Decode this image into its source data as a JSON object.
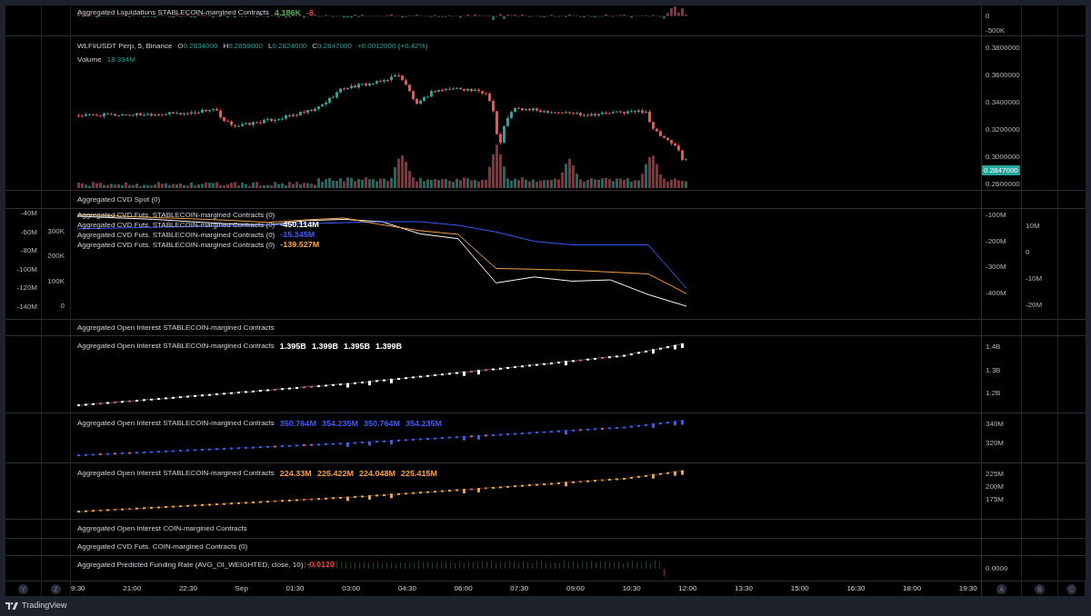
{
  "panes": [
    {
      "kind": "liquidations",
      "title": "Aggregated Liquidations STABLECOIN-margined Contracts",
      "values": [
        {
          "text": "4.186K",
          "color": "#4caf50"
        },
        {
          "text": "-8",
          "color": "#f23645"
        }
      ],
      "right_ticks": [
        "0",
        "-500K"
      ]
    },
    {
      "kind": "price",
      "title": "WLFI/USDT Perp, 5, Binance",
      "ohlc": [
        {
          "label": "O",
          "value": "0.2834000"
        },
        {
          "label": "H",
          "value": "0.2859000"
        },
        {
          "label": "L",
          "value": "0.2824000"
        },
        {
          "label": "C",
          "value": "0.2847000"
        }
      ],
      "change": "+0.0012000 (+0.42%)",
      "volume": {
        "label": "Volume",
        "value": "18.394M"
      },
      "right_ticks": [
        "0.3800000",
        "0.3600000",
        "0.3400000",
        "0.3200000",
        "0.3000000",
        "0.2600000"
      ],
      "last_price": "0.2847000"
    },
    {
      "kind": "header",
      "title": "Aggregated CVD Spot (0)"
    },
    {
      "kind": "cvd",
      "chart_data": {
        "type": "line",
        "ylim": [
          -501,
          -76
        ],
        "yticks": [
          {
            "value": -100,
            "label": "-100M"
          },
          {
            "value": -200,
            "label": "-200M"
          },
          {
            "value": -300,
            "label": "-300M"
          },
          {
            "value": -400,
            "label": "-400M"
          }
        ],
        "series": [
          {
            "color": "#ffffff",
            "values": [
              -104,
              -110,
              -116,
              -125,
              -134,
              -138,
              -121,
              -116,
              -125,
              -172,
              -191,
              -362,
              -339,
              -355,
              -350,
              -407,
              -452
            ]
          },
          {
            "color": "#3d5afe",
            "values": [
              -153,
              -150,
              -147,
              -144,
              -141,
              -138,
              -133,
              -129,
              -125,
              -125,
              -139,
              -165,
              -201,
              -215,
              -215,
              -215,
              -383
            ]
          },
          {
            "color": "#f5a142",
            "values": [
              -97,
              -103,
              -109,
              -114,
              -120,
              -128,
              -118,
              -111,
              -137,
              -160,
              -174,
              -306,
              -309,
              -313,
              -320,
              -327,
              -403
            ]
          }
        ]
      },
      "legends": [
        {
          "title": "Aggregated CVD Futs. STABLECOIN-margined Contracts (0)"
        },
        {
          "title": "Aggregated CVD Futs. STABLECOIN-margined Contracts (0)",
          "value": "-450.114M",
          "color": "#ffffff"
        },
        {
          "title": "Aggregated CVD Futs. STABLECOIN-margined Contracts (0)",
          "value": "-15.345M",
          "color": "#3d5afe"
        },
        {
          "title": "Aggregated CVD Futs. STABLECOIN-margined Contracts (0)",
          "value": "-139.527M",
          "color": "#f5a142"
        }
      ],
      "left_ticks": [
        "-40M",
        "-60M",
        "-80M",
        "-100M",
        "-120M",
        "-140M"
      ],
      "left_ticks_2": [
        "300K",
        "200K",
        "100K",
        "0"
      ],
      "right_ticks_2": [
        "10M",
        "0",
        "-10M",
        "-20M"
      ]
    },
    {
      "kind": "header",
      "title": "Aggregated Open Interest STABLECOIN-margined Contracts"
    },
    {
      "kind": "oi",
      "title": "Aggregated Open Interest STABLECOIN-margined Contracts",
      "values": [
        {
          "text": "1.395B",
          "color": "#ffffff"
        },
        {
          "text": "1.399B",
          "color": "#ffffff"
        },
        {
          "text": "1.395B",
          "color": "#ffffff"
        },
        {
          "text": "1.399B",
          "color": "#ffffff"
        }
      ],
      "right_ticks": [
        "1.4B",
        "1.3B",
        "1.2B"
      ]
    },
    {
      "kind": "oi",
      "title": "Aggregated Open Interest STABLECOIN-margined Contracts",
      "values": [
        {
          "text": "350.764M",
          "color": "#3d5afe"
        },
        {
          "text": "354.235M",
          "color": "#3d5afe"
        },
        {
          "text": "350.764M",
          "color": "#3d5afe"
        },
        {
          "text": "354.235M",
          "color": "#3d5afe"
        }
      ],
      "right_ticks": [
        "340M",
        "320M"
      ]
    },
    {
      "kind": "oi",
      "title": "Aggregated Open Interest STABLECOIN-margined Contracts",
      "values": [
        {
          "text": "224.33M",
          "color": "#f5a142"
        },
        {
          "text": "225.422M",
          "color": "#f5a142"
        },
        {
          "text": "224.048M",
          "color": "#f5a142"
        },
        {
          "text": "225.415M",
          "color": "#f5a142"
        }
      ],
      "right_ticks": [
        "225M",
        "200M",
        "175M"
      ]
    },
    {
      "kind": "header",
      "title": "Aggregated Open Interest COIN-margined Contracts"
    },
    {
      "kind": "header",
      "title": "Aggregated CVD Futs. COIN-margined Contracts (0)"
    },
    {
      "kind": "funding",
      "title": "Aggregated Predicted Funding Rate (AVG_OI_WEIGHTED, close, 10)",
      "values": [
        {
          "text": "-0.0120",
          "color": "#f23645"
        }
      ],
      "right_ticks": [
        "0.0000"
      ]
    }
  ],
  "time_axis": {
    "left_buttons": [
      "Y",
      "Z"
    ],
    "labels": [
      "9:30",
      "21:00",
      "22:30",
      "Sep",
      "01:30",
      "03:00",
      "04:30",
      "06:00",
      "07:30",
      "09:00",
      "10:30",
      "12:00",
      "13:30",
      "15:00",
      "16:30",
      "18:00",
      "19:30"
    ],
    "right_buttons": [
      "A",
      "B",
      "C"
    ]
  },
  "footer": {
    "brand": "TradingView"
  }
}
